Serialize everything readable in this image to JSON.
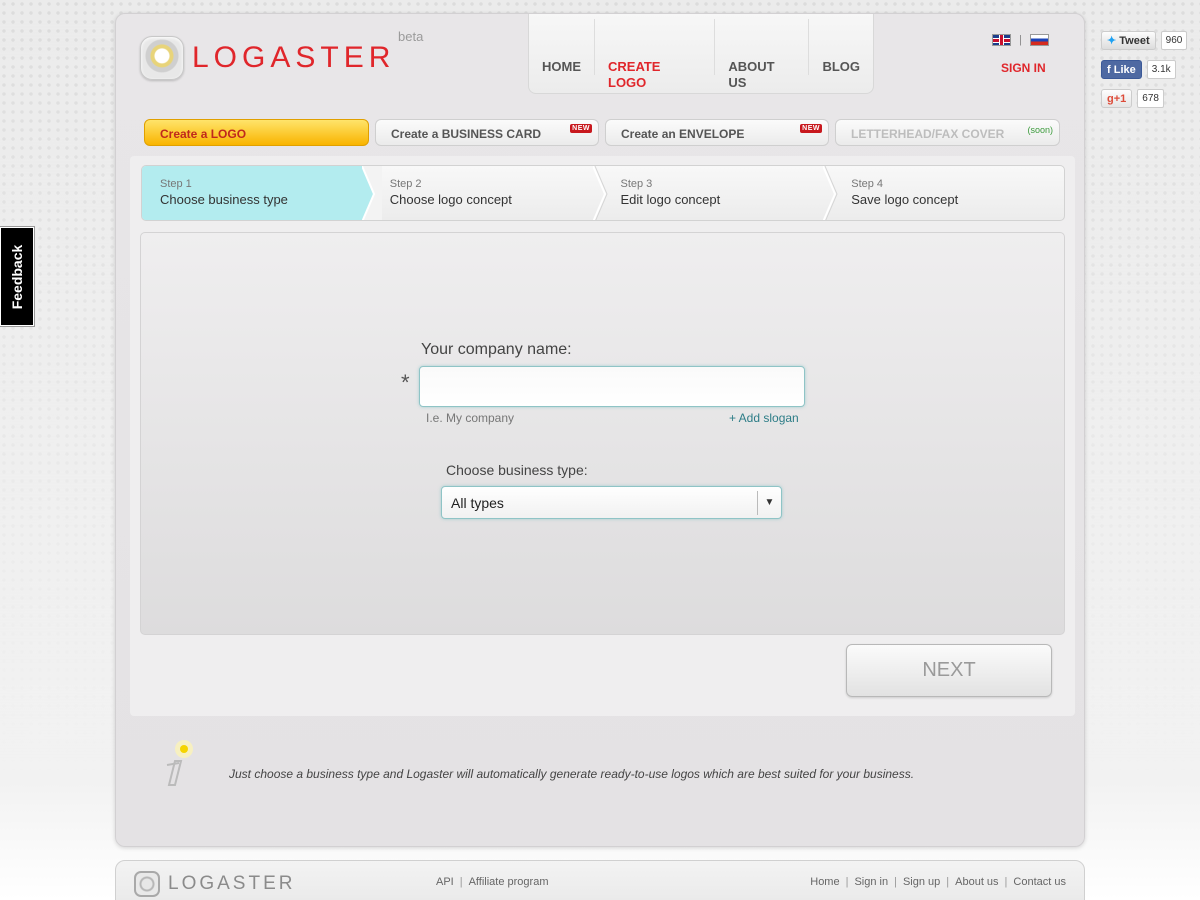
{
  "header": {
    "logo_text": "LOGASTER",
    "logo_beta": "beta",
    "nav": [
      "HOME",
      "CREATE LOGO",
      "ABOUT US",
      "BLOG"
    ],
    "lang_separator": "|",
    "sign_in": "SIGN IN"
  },
  "product_tabs": [
    {
      "label": "Create a LOGO",
      "badge": ""
    },
    {
      "label": "Create a BUSINESS CARD",
      "badge": "NEW"
    },
    {
      "label": "Create an ENVELOPE",
      "badge": "NEW"
    },
    {
      "label": "LETTERHEAD/FAX COVER",
      "badge": "(soon)"
    }
  ],
  "steps": [
    {
      "num": "Step 1",
      "title": "Choose business type"
    },
    {
      "num": "Step 2",
      "title": "Choose logo concept"
    },
    {
      "num": "Step 3",
      "title": "Edit logo concept"
    },
    {
      "num": "Step 4",
      "title": "Save logo concept"
    }
  ],
  "form": {
    "company_label": "Your company name:",
    "required_mark": "*",
    "company_value": "",
    "hint": "I.e. My company",
    "add_slogan": "+ Add slogan",
    "business_type_label": "Choose business type:",
    "business_type_value": "All types"
  },
  "next_label": "NEXT",
  "info_text": "Just choose a business type and Logaster will automatically generate ready-to-use logos which are best suited for your business.",
  "footer": {
    "logo_text": "LOGASTER",
    "mid_links": [
      "API",
      "Affiliate program"
    ],
    "right_links": [
      "Home",
      "Sign in",
      "Sign up",
      "About us",
      "Contact us"
    ]
  },
  "social": {
    "tweet_label": "Tweet",
    "tweet_count": "960",
    "like_label": "Like",
    "like_count": "3.1k",
    "gplus_label": "+1",
    "gplus_count": "678"
  },
  "feedback_label": "Feedback",
  "colors": {
    "brand_red": "#e0262b",
    "active_step": "#b3ecef",
    "active_tab": "#f9b400"
  }
}
